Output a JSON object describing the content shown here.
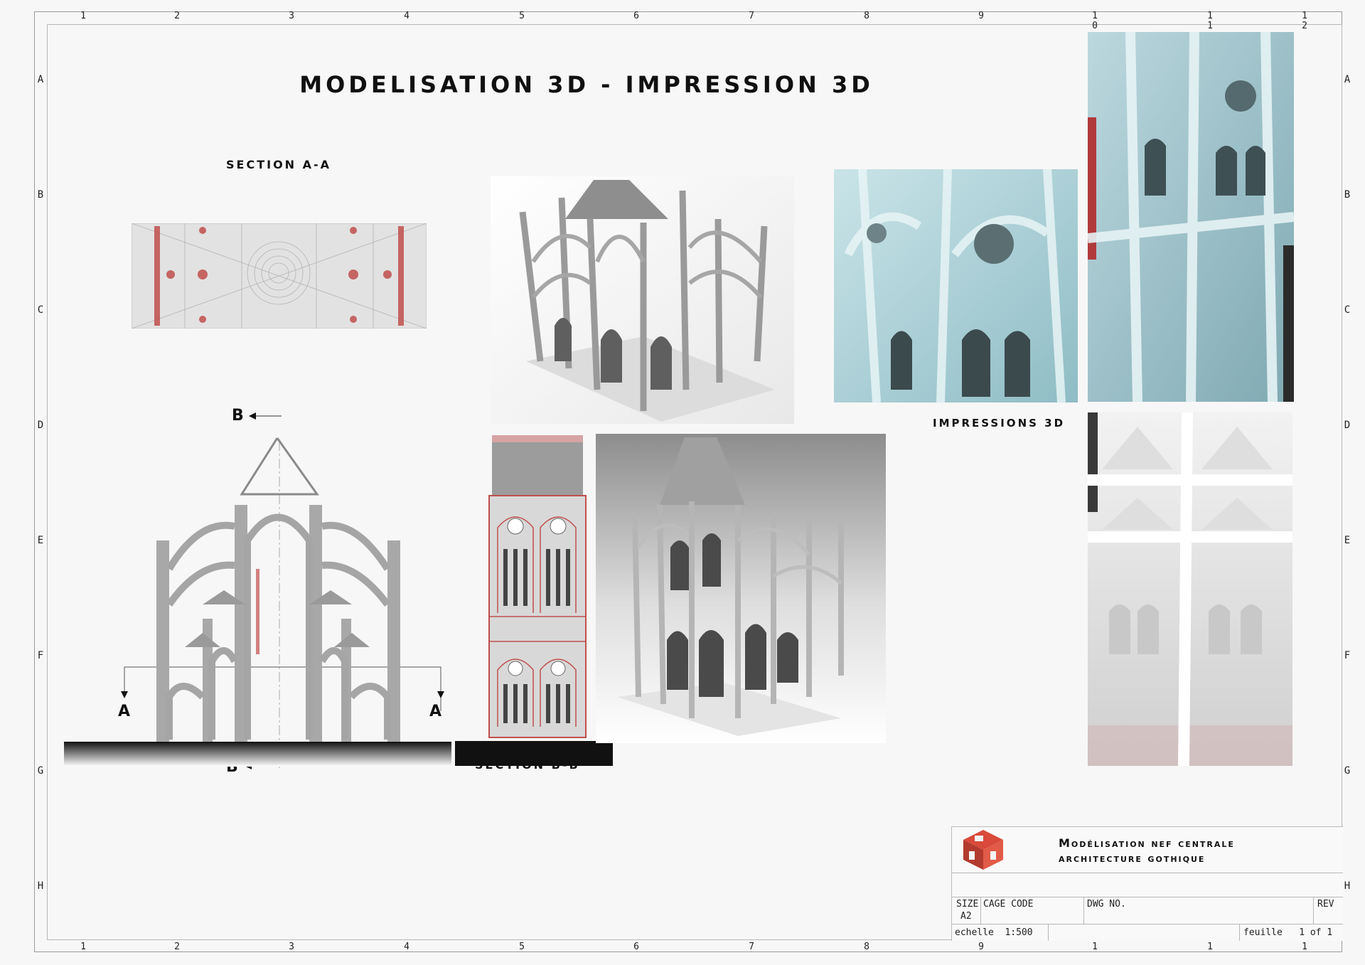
{
  "sheet": {
    "title": "MODELISATION 3D - IMPRESSION 3D",
    "columns": [
      "1",
      "2",
      "3",
      "4",
      "5",
      "6",
      "7",
      "8",
      "9"
    ],
    "columns_multi": [
      [
        "1",
        "0"
      ],
      [
        "1",
        "1"
      ],
      [
        "1",
        "2"
      ]
    ],
    "rows": [
      "A",
      "B",
      "C",
      "D",
      "E",
      "F",
      "G",
      "H"
    ]
  },
  "labels": {
    "section_aa": "SECTION A-A",
    "section_bb": "SECTION B-B",
    "impressions": "IMPRESSIONS 3D",
    "marker_b": "B",
    "marker_a": "A"
  },
  "title_block": {
    "project_line1": "Modélisation nef centrale",
    "project_line2": "architecture gothique",
    "size_label": "SIZE",
    "size_value": "A2",
    "cage_label": "CAGE CODE",
    "dwg_label": "DWG NO.",
    "rev_label": "REV",
    "scale_label": "echelle",
    "scale_value": "1:500",
    "sheet_label": "feuille",
    "sheet_value": "1 of 1"
  },
  "colors": {
    "accent_red": "#c0504d",
    "model_gray": "#9a9a9a",
    "print_cyan": "#a9cfd6",
    "print_white": "#ececec"
  },
  "icons": {
    "logo": "cube-logo-icon",
    "section_arrow": "arrow-left-icon",
    "section_arrow_down": "arrow-down-icon"
  }
}
